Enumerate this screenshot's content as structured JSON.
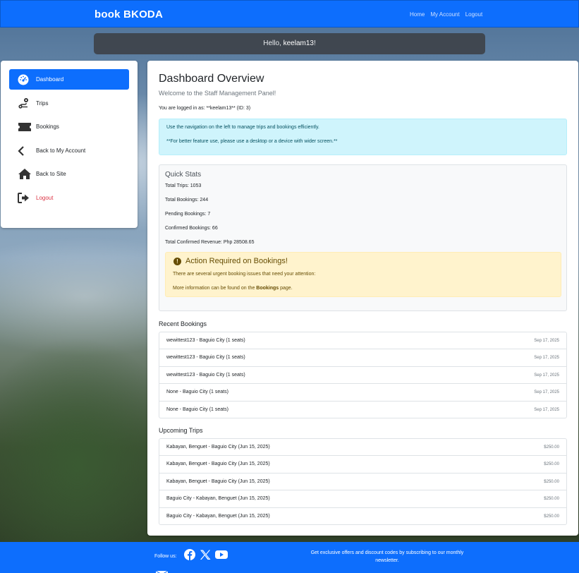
{
  "navbar": {
    "brand": "book BKODA",
    "links": [
      "Home",
      "My Account",
      "Logout"
    ]
  },
  "greeting": {
    "prefix": "Hello, ",
    "username": "keelam13",
    "suffix": "!"
  },
  "sidebar": {
    "items": [
      {
        "label": "Dashboard",
        "icon": "dashboard-gauge-icon"
      },
      {
        "label": "Trips",
        "icon": "route-icon"
      },
      {
        "label": "Bookings",
        "icon": "ticket-icon"
      },
      {
        "label": "Back to My Account",
        "icon": "chevron-left-icon"
      },
      {
        "label": "Back to Site",
        "icon": "home-icon"
      },
      {
        "label": "Logout",
        "icon": "sign-out-icon"
      }
    ]
  },
  "main": {
    "title": "Dashboard Overview",
    "subtitle": "Welcome to the Staff Management Panel!",
    "logged_in": "You are logged in as: **keelam13** (ID: 3)",
    "info": {
      "line1": "Use the navigation on the left to manage trips and bookings efficiently.",
      "line2": "**For better feature use, please use a desktop or a device with wider screen.**"
    },
    "stats": {
      "title": "Quick Stats",
      "lines": [
        "Total Trips: 1053",
        "Total Bookings: 244",
        "Pending Bookings: 7",
        "Confirmed Bookings: 66",
        "Total Confirmed Revenue: Php 28508.65"
      ]
    },
    "alert": {
      "title": "Action Required on Bookings!",
      "line1": "There are several urgent booking issues that need your attention:",
      "line2_prefix": "More information can be found on the ",
      "line2_link": "Bookings",
      "line2_suffix": " page."
    },
    "recent_bookings": {
      "title": "Recent Bookings",
      "rows": [
        {
          "desc": "wewittest123 - Baguio City (1 seats)",
          "date": "Sep 17, 2025"
        },
        {
          "desc": "wewittest123 - Baguio City (1 seats)",
          "date": "Sep 17, 2025"
        },
        {
          "desc": "wewittest123 - Baguio City (1 seats)",
          "date": "Sep 17, 2025"
        },
        {
          "desc": "None - Baguio City (1 seats)",
          "date": "Sep 17, 2025"
        },
        {
          "desc": "None - Baguio City (1 seats)",
          "date": "Sep 17, 2025"
        }
      ]
    },
    "upcoming_trips": {
      "title": "Upcoming Trips",
      "rows": [
        {
          "desc": "Kabayan, Benguet - Baguio City (Jun 15, 2025)",
          "price": "$250.00"
        },
        {
          "desc": "Kabayan, Benguet - Baguio City (Jun 15, 2025)",
          "price": "$250.00"
        },
        {
          "desc": "Kabayan, Benguet - Baguio City (Jun 15, 2025)",
          "price": "$250.00"
        },
        {
          "desc": "Baguio City - Kabayan, Benguet (Jun 15, 2025)",
          "price": "$250.00"
        },
        {
          "desc": "Baguio City - Kabayan, Benguet (Jun 15, 2025)",
          "price": "$250.00"
        }
      ]
    }
  },
  "footer": {
    "follow_label": "Follow us:",
    "socials": [
      "facebook-icon",
      "x-twitter-icon",
      "youtube-icon"
    ],
    "newsletter": "Get exclusive offers and discount codes by subscribing to our monthly newsletter."
  },
  "colors": {
    "primary": "#0d6efd",
    "info_bg": "#cff4fc",
    "warning_bg": "#fff3cd",
    "danger": "#dc3545"
  }
}
